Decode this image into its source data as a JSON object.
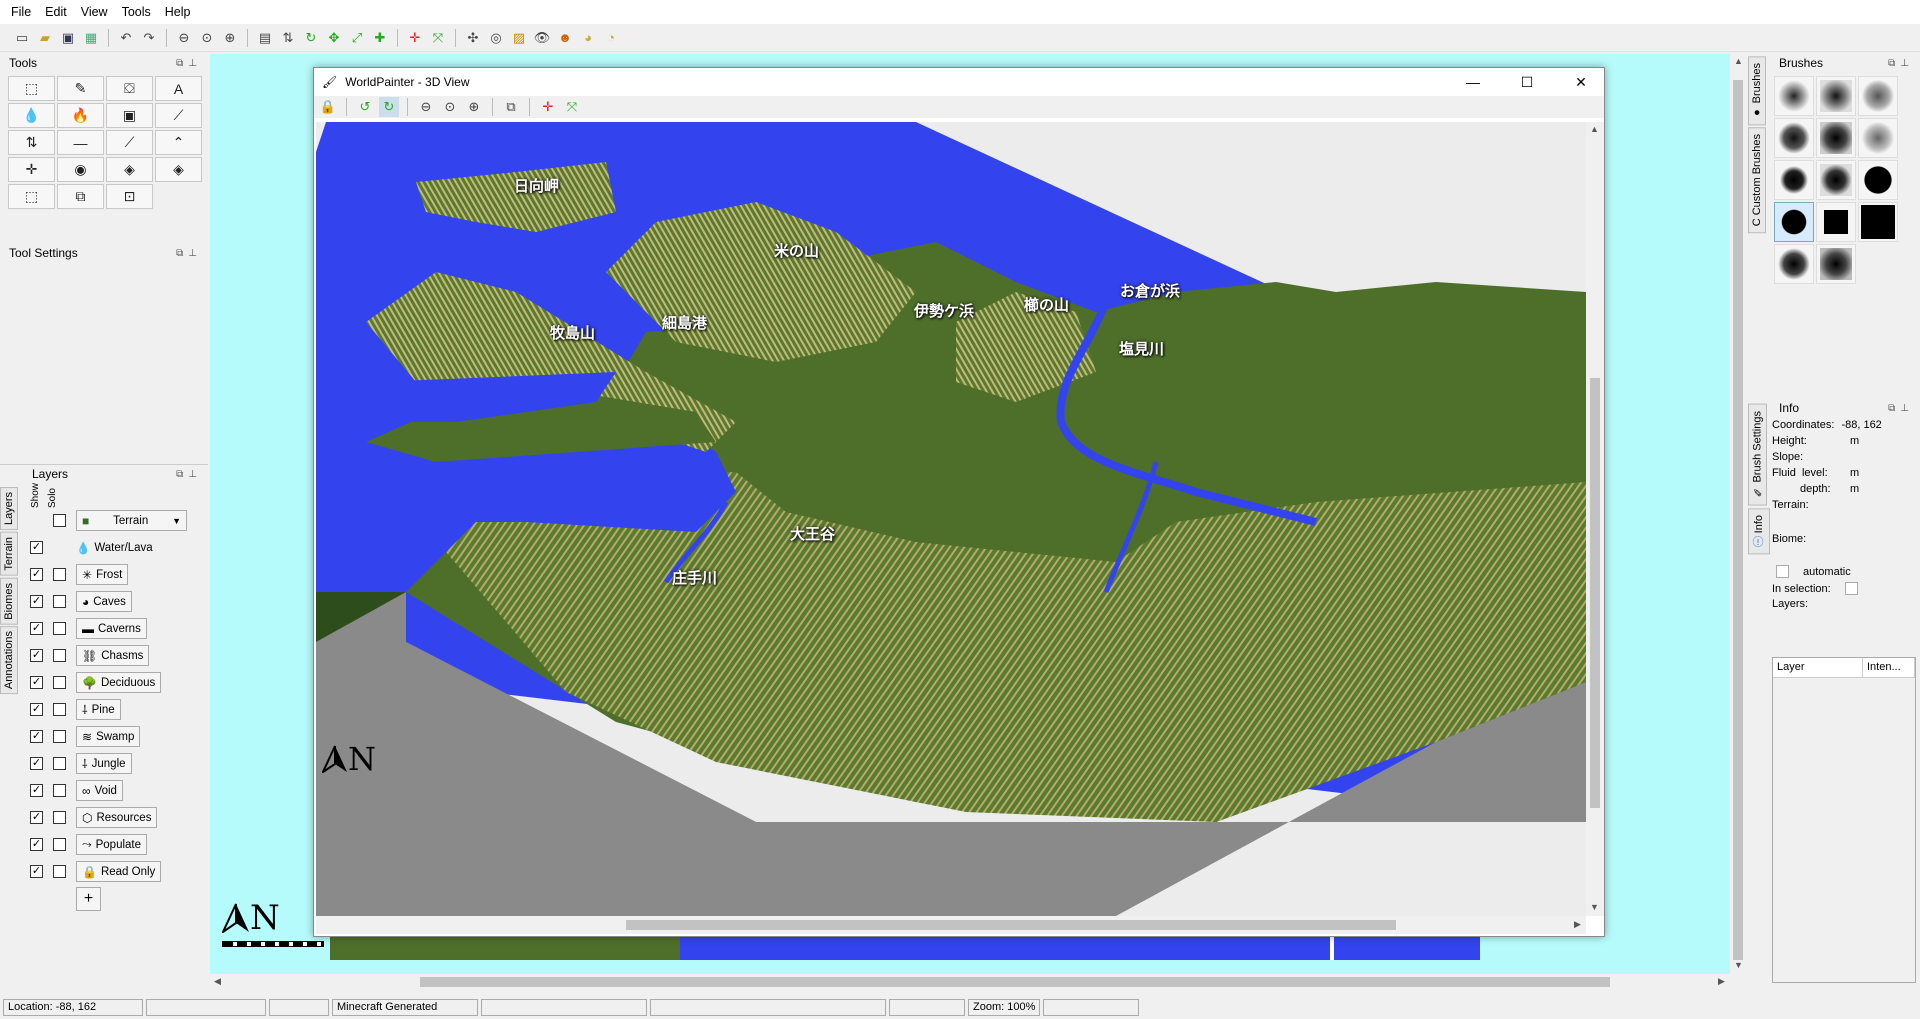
{
  "menu": [
    "File",
    "Edit",
    "View",
    "Tools",
    "Help"
  ],
  "toolbar_icons": [
    "new-icon",
    "open-icon",
    "save-icon",
    "export-icon",
    "undo-icon",
    "redo-icon",
    "zoom-out-icon",
    "zoom-reset-icon",
    "zoom-in-icon",
    "dimension-icon",
    "height-icon",
    "rotate-icon",
    "shift-icon",
    "scale-icon",
    "add-tiles-icon",
    "center-icon",
    "fit-icon",
    "move-icon",
    "target-icon",
    "image-icon",
    "eye-icon",
    "user-icon",
    "globe-icon",
    "cog-icon"
  ],
  "tools_panel": {
    "title": "Tools",
    "tools": [
      {
        "name": "select-icon",
        "glyph": "⬚"
      },
      {
        "name": "pencil-icon",
        "glyph": "✎"
      },
      {
        "name": "fill-icon",
        "glyph": "⛋"
      },
      {
        "name": "text-icon",
        "glyph": "A"
      },
      {
        "name": "water-icon",
        "glyph": "💧"
      },
      {
        "name": "lava-icon",
        "glyph": "🔥"
      },
      {
        "name": "sponge-icon",
        "glyph": "▣"
      },
      {
        "name": "dropper-icon",
        "glyph": "⟋"
      },
      {
        "name": "flatten-icon",
        "glyph": "⇅"
      },
      {
        "name": "level-icon",
        "glyph": "—"
      },
      {
        "name": "slope-icon",
        "glyph": "⟋"
      },
      {
        "name": "raise-icon",
        "glyph": "⌃"
      },
      {
        "name": "smooth-icon",
        "glyph": "✛"
      },
      {
        "name": "mountain-icon",
        "glyph": "◉"
      },
      {
        "name": "pyramid-icon",
        "glyph": "◈"
      },
      {
        "name": "pyramid2-icon",
        "glyph": "◈"
      },
      {
        "name": "selection-icon",
        "glyph": "⬚"
      },
      {
        "name": "copy-selection-icon",
        "glyph": "⧉"
      },
      {
        "name": "clear-selection-icon",
        "glyph": "⊡"
      }
    ]
  },
  "tool_settings": {
    "title": "Tool Settings"
  },
  "layers_panel": {
    "title": "Layers",
    "show_label": "Show",
    "solo_label": "Solo",
    "side_tabs": [
      "Layers",
      "Terrain",
      "Biomes",
      "Annotations"
    ],
    "terrain_select": "Terrain",
    "items": [
      {
        "label": "Water/Lava",
        "show": true,
        "solo": null,
        "icon": "water-icon",
        "glyph": "💧",
        "button": false
      },
      {
        "label": "Frost",
        "show": true,
        "solo": false,
        "icon": "frost-icon",
        "glyph": "✳",
        "button": true
      },
      {
        "label": "Caves",
        "show": true,
        "solo": false,
        "icon": "caves-icon",
        "glyph": "◕",
        "button": true
      },
      {
        "label": "Caverns",
        "show": true,
        "solo": false,
        "icon": "caverns-icon",
        "glyph": "▬",
        "button": true
      },
      {
        "label": "Chasms",
        "show": true,
        "solo": false,
        "icon": "chasms-icon",
        "glyph": "⛓",
        "button": true
      },
      {
        "label": "Deciduous",
        "show": true,
        "solo": false,
        "icon": "tree-icon",
        "glyph": "🌳",
        "button": true
      },
      {
        "label": "Pine",
        "show": true,
        "solo": false,
        "icon": "pine-icon",
        "glyph": "⸸",
        "button": true
      },
      {
        "label": "Swamp",
        "show": true,
        "solo": false,
        "icon": "swamp-icon",
        "glyph": "≋",
        "button": true
      },
      {
        "label": "Jungle",
        "show": true,
        "solo": false,
        "icon": "jungle-icon",
        "glyph": "⸸",
        "button": true
      },
      {
        "label": "Void",
        "show": true,
        "solo": false,
        "icon": "void-icon",
        "glyph": "∞",
        "button": true
      },
      {
        "label": "Resources",
        "show": true,
        "solo": false,
        "icon": "resources-icon",
        "glyph": "⬡",
        "button": true
      },
      {
        "label": "Populate",
        "show": true,
        "solo": false,
        "icon": "populate-icon",
        "glyph": "⤳",
        "button": true
      },
      {
        "label": "Read Only",
        "show": true,
        "solo": false,
        "icon": "lock-icon",
        "glyph": "🔒",
        "button": true
      }
    ],
    "add_label": "+"
  },
  "view3d": {
    "title": "WorldPainter - 3D View",
    "minimize": "—",
    "maximize": "☐",
    "close": "✕",
    "toolbar_icons": [
      "lock-icon",
      "rotate-left-icon",
      "rotate-right-icon",
      "zoom-out-icon",
      "zoom-reset-icon",
      "zoom-in-icon",
      "export-image-icon",
      "center-icon",
      "fit-icon"
    ],
    "labels": [
      {
        "name": "hyuga-misaki",
        "text": "日向岬"
      },
      {
        "name": "kome-no-yama",
        "text": "米の山"
      },
      {
        "name": "hososhima-port",
        "text": "細島港"
      },
      {
        "name": "makishima-yama",
        "text": "牧島山"
      },
      {
        "name": "isegahama",
        "text": "伊勢ケ浜"
      },
      {
        "name": "yanagi-no-yama",
        "text": "櫛の山"
      },
      {
        "name": "okuragahama",
        "text": "お倉が浜"
      },
      {
        "name": "shiomi-river",
        "text": "塩見川"
      },
      {
        "name": "daiodani",
        "text": "大王谷"
      },
      {
        "name": "shote-river",
        "text": "庄手川"
      }
    ],
    "north_label": "N"
  },
  "main_north_label": "N",
  "brushes_panel": {
    "title": "Brushes",
    "side_tabs": [
      "Brushes",
      "Custom Brushes"
    ],
    "brushes": [
      "soft-circle",
      "soft-square",
      "noise-circle",
      "medium-circle",
      "medium-square",
      "noise-square",
      "hard-circle-small",
      "hard-square-small",
      "solid-circle-large",
      "solid-circle-selected",
      "solid-square",
      "solid-square-large",
      "spiky-circle",
      "spiky-square"
    ]
  },
  "info_panel": {
    "title": "Info",
    "side_tabs": [
      "Brush Settings",
      "Info"
    ],
    "coordinates_label": "Coordinates:",
    "coordinates_value": "-88, 162",
    "height_label": "Height:",
    "height_unit": "m",
    "slope_label": "Slope:",
    "fluid_level_label": "Fluid  level:",
    "fluid_level_unit": "m",
    "depth_label": "depth:",
    "depth_unit": "m",
    "terrain_label": "Terrain:",
    "biome_label": "Biome:",
    "automatic_label": "automatic",
    "in_selection_label": "In selection:",
    "layers_label": "Layers:",
    "table_headers": [
      "Layer",
      "Inten..."
    ]
  },
  "statusbar": {
    "location": "Location: -88, 162",
    "cell2": "",
    "cell3": "",
    "generator": "Minecraft Generated",
    "cell5": "",
    "cell6": "",
    "cell7": "",
    "zoom": "Zoom: 100%",
    "cell9": ""
  },
  "colors": {
    "canvas_bg": "#b6fbfb",
    "water": "#3344ee",
    "grass": "#4d6f2a",
    "terrain_highlight": "#b4ab6a",
    "bedrock": "#8a8a8a"
  }
}
